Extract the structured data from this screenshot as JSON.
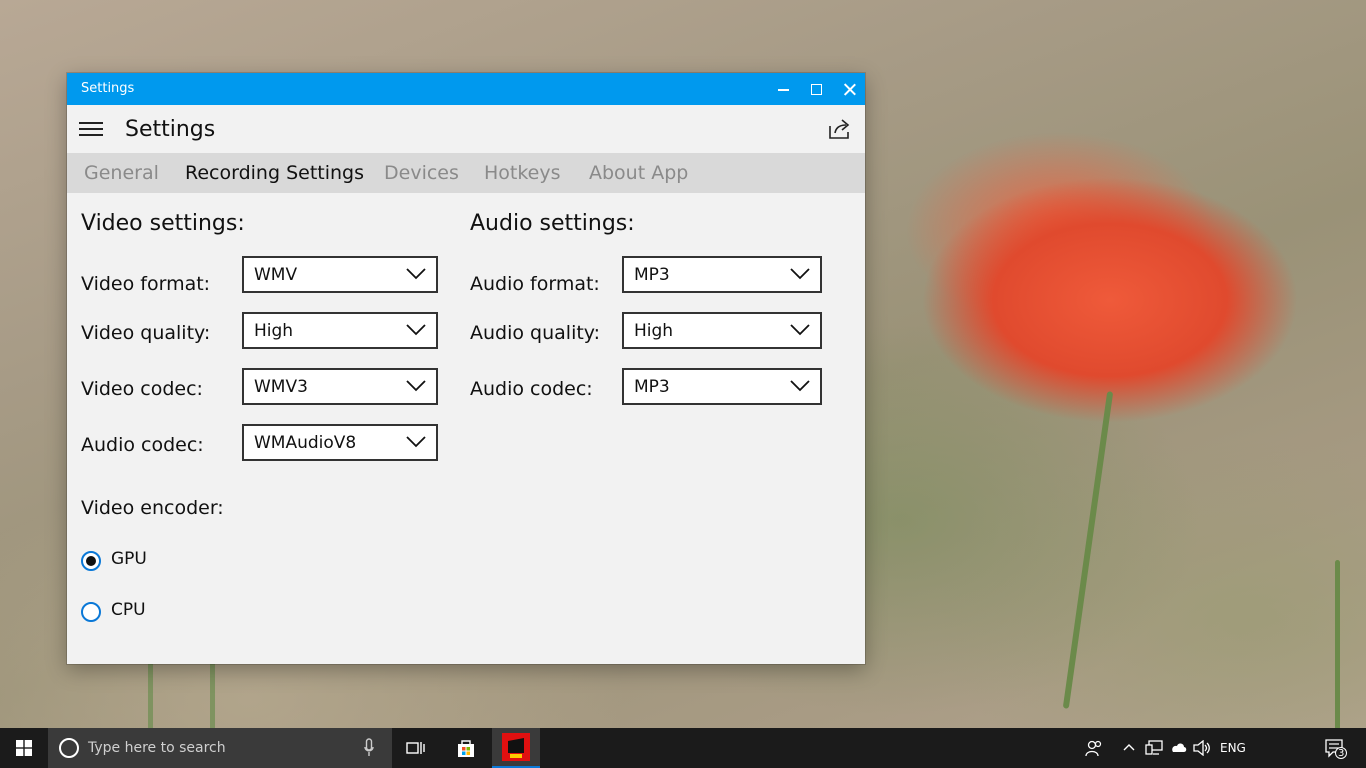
{
  "window": {
    "title": "Settings",
    "header_title": "Settings"
  },
  "tabs": [
    {
      "label": "General",
      "active": false
    },
    {
      "label": "Recording Settings",
      "active": true
    },
    {
      "label": "Devices",
      "active": false
    },
    {
      "label": "Hotkeys",
      "active": false
    },
    {
      "label": "About App",
      "active": false
    }
  ],
  "video": {
    "title": "Video settings:",
    "format": {
      "label": "Video format:",
      "value": "WMV"
    },
    "quality": {
      "label": "Video quality:",
      "value": "High"
    },
    "codec": {
      "label": "Video codec:",
      "value": "WMV3"
    },
    "audio_codec": {
      "label": "Audio codec:",
      "value": "WMAudioV8"
    },
    "encoder": {
      "label": "Video encoder:",
      "options": [
        {
          "label": "GPU",
          "checked": true
        },
        {
          "label": "CPU",
          "checked": false
        }
      ]
    }
  },
  "audio": {
    "title": "Audio settings:",
    "format": {
      "label": "Audio format:",
      "value": "MP3"
    },
    "quality": {
      "label": "Audio quality:",
      "value": "High"
    },
    "codec": {
      "label": "Audio codec:",
      "value": "MP3"
    }
  },
  "taskbar": {
    "search_placeholder": "Type here to search",
    "language": "ENG",
    "notification_count": "3"
  },
  "colors": {
    "titlebar": "#0099ee",
    "accent": "#0a78d7",
    "taskbar": "#1b1b1b"
  }
}
